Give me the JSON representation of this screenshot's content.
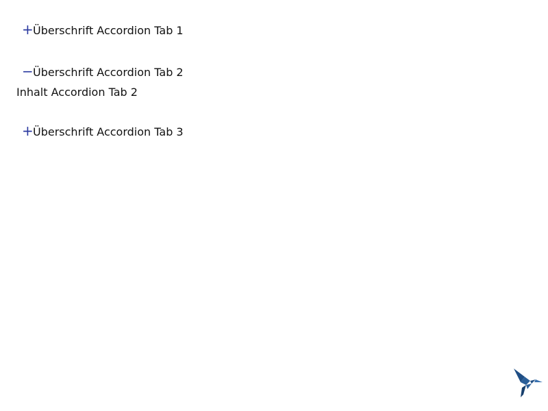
{
  "accordion": {
    "tabs": [
      {
        "toggle": "+",
        "title": "Überschrift Accordion Tab 1",
        "expanded": false
      },
      {
        "toggle": "−",
        "title": "Überschrift Accordion Tab 2",
        "expanded": true,
        "content": "Inhalt Accordion Tab 2"
      },
      {
        "toggle": "+",
        "title": "Überschrift Accordion Tab 3",
        "expanded": false
      }
    ]
  },
  "colors": {
    "toggle": "#2b3aa0",
    "logo": "#1f4e85"
  },
  "icons": {
    "logo": "hummingbird-logo-icon"
  }
}
